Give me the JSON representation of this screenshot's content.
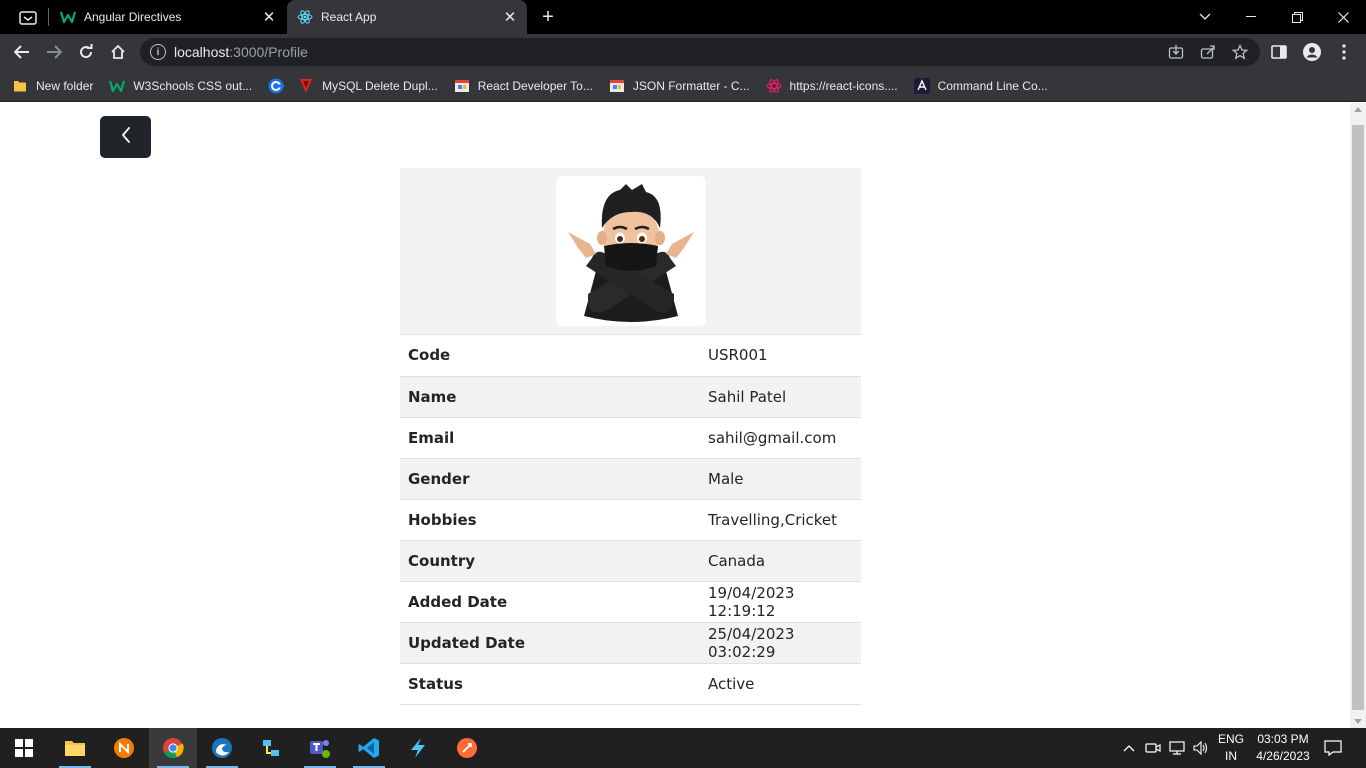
{
  "browser": {
    "tabs": [
      {
        "title": "Angular Directives",
        "icon": "w3schools-icon",
        "active": false
      },
      {
        "title": "React App",
        "icon": "react-icon",
        "active": true
      }
    ],
    "url": {
      "host": "localhost",
      "path": ":3000/Profile"
    },
    "bookmarks": [
      {
        "label": "New folder",
        "icon": "folder-icon"
      },
      {
        "label": "W3Schools CSS out...",
        "icon": "w3schools-icon"
      },
      {
        "label": "",
        "icon": "chrome-web-store-icon"
      },
      {
        "label": "MySQL Delete Dupl...",
        "icon": "mysql-icon"
      },
      {
        "label": "React Developer To...",
        "icon": "chrome-web-store-icon"
      },
      {
        "label": "JSON Formatter - C...",
        "icon": "chrome-web-store-icon"
      },
      {
        "label": "https://react-icons....",
        "icon": "react-icons-icon"
      },
      {
        "label": "Command Line Co...",
        "icon": "angular-cli-icon"
      }
    ]
  },
  "page": {
    "back_button_icon": "chevron-left-icon",
    "profile": {
      "avatar": "avatar-image",
      "rows": [
        {
          "label": "Code",
          "value": "USR001"
        },
        {
          "label": "Name",
          "value": "Sahil Patel"
        },
        {
          "label": "Email",
          "value": "sahil@gmail.com"
        },
        {
          "label": "Gender",
          "value": "Male"
        },
        {
          "label": "Hobbies",
          "value": "Travelling,Cricket"
        },
        {
          "label": "Country",
          "value": "Canada"
        },
        {
          "label": "Added Date",
          "value": "19/04/2023 12:19:12"
        },
        {
          "label": "Updated Date",
          "value": "25/04/2023 03:02:29"
        },
        {
          "label": "Status",
          "value": "Active"
        }
      ]
    }
  },
  "taskbar": {
    "lang": {
      "line1": "ENG",
      "line2": "IN"
    },
    "clock": {
      "time": "03:03 PM",
      "date": "4/26/2023"
    }
  },
  "colors": {
    "back_button": "#212529",
    "row_stripe": "#f2f2f2",
    "tab_active": "#35363a"
  }
}
